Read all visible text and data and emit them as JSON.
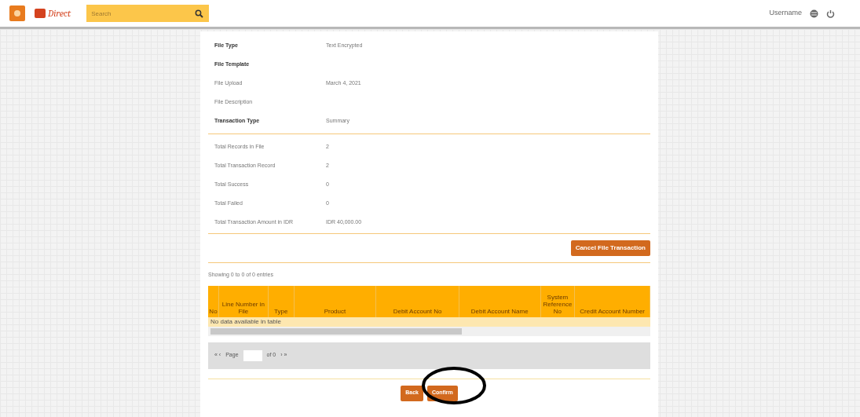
{
  "header": {
    "brand": "Direct",
    "search": {
      "placeholder": "Search"
    },
    "user": "Username"
  },
  "file_info": [
    {
      "label": "File Type",
      "value": "Text Encrypted",
      "bold": true
    },
    {
      "label": "File Template",
      "bold": true
    },
    {
      "label": "File Upload",
      "value": "March 4, 2021",
      "bold": false
    },
    {
      "label": "File Description",
      "bold": false
    },
    {
      "label": "Transaction Type",
      "value": "Summary",
      "bold": true
    }
  ],
  "totals": [
    {
      "label": "Total Records in File",
      "value": "2"
    },
    {
      "label": "Total Transaction Record",
      "value": "2"
    },
    {
      "label": "Total Success",
      "value": "0"
    },
    {
      "label": "Total Failed",
      "value": "0"
    },
    {
      "label": "Total Transaction Amount in IDR",
      "value": "IDR 40,000.00"
    }
  ],
  "cancel_button": "Cancel File Transaction",
  "table": {
    "info": "Showing 0 to 0 of 0 entries",
    "columns": [
      "No",
      "Line Number in File",
      "Type",
      "Product",
      "Debit Account No",
      "Debit Account Name",
      "System Reference No",
      "Credit Account Number"
    ],
    "empty_message": "No data available in table",
    "pager": {
      "first": "« ‹",
      "page_label": "Page",
      "of": "of 0",
      "last": "› »"
    }
  },
  "buttons": [
    "Back",
    "Confirm"
  ]
}
